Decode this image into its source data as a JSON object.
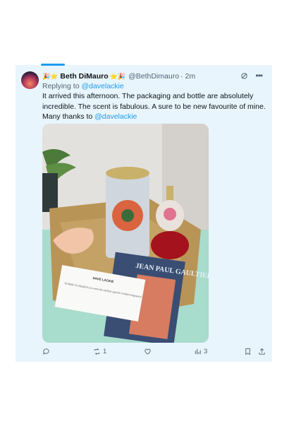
{
  "post": {
    "author": {
      "display_name": "Beth DiMauro",
      "handle": "@BethDimauro",
      "separator": "·",
      "time": "2m",
      "emoji_left": "🎉⭐",
      "emoji_right": "⭐🎉"
    },
    "replying_prefix": "Replying to ",
    "replying_to": "@davelackie",
    "text_body": "It arrived this afternoon. The packaging and bottle are absolutely incredible. The scent is fabulous. A sure to be new favourite of mine. Many thanks to ",
    "text_mention": "@davelackie",
    "media": {
      "magazine_title": "JEAN PAUL GAULTIER",
      "card_header": "DAVE LACKIE",
      "card_note": "Hi Beth! So thankful you were the earliest special Gaultier fragrance!"
    }
  },
  "actions": {
    "reply_count": "",
    "repost_count": "1",
    "like_count": "",
    "views_count": "3"
  },
  "icons": [
    "reply-icon",
    "repost-icon",
    "like-icon",
    "views-icon",
    "bookmark-icon",
    "share-icon",
    "grok-icon",
    "more-icon"
  ],
  "colors": {
    "accent": "#1d9bf0",
    "muted": "#536471",
    "card_bg": "#e8f5fd"
  }
}
